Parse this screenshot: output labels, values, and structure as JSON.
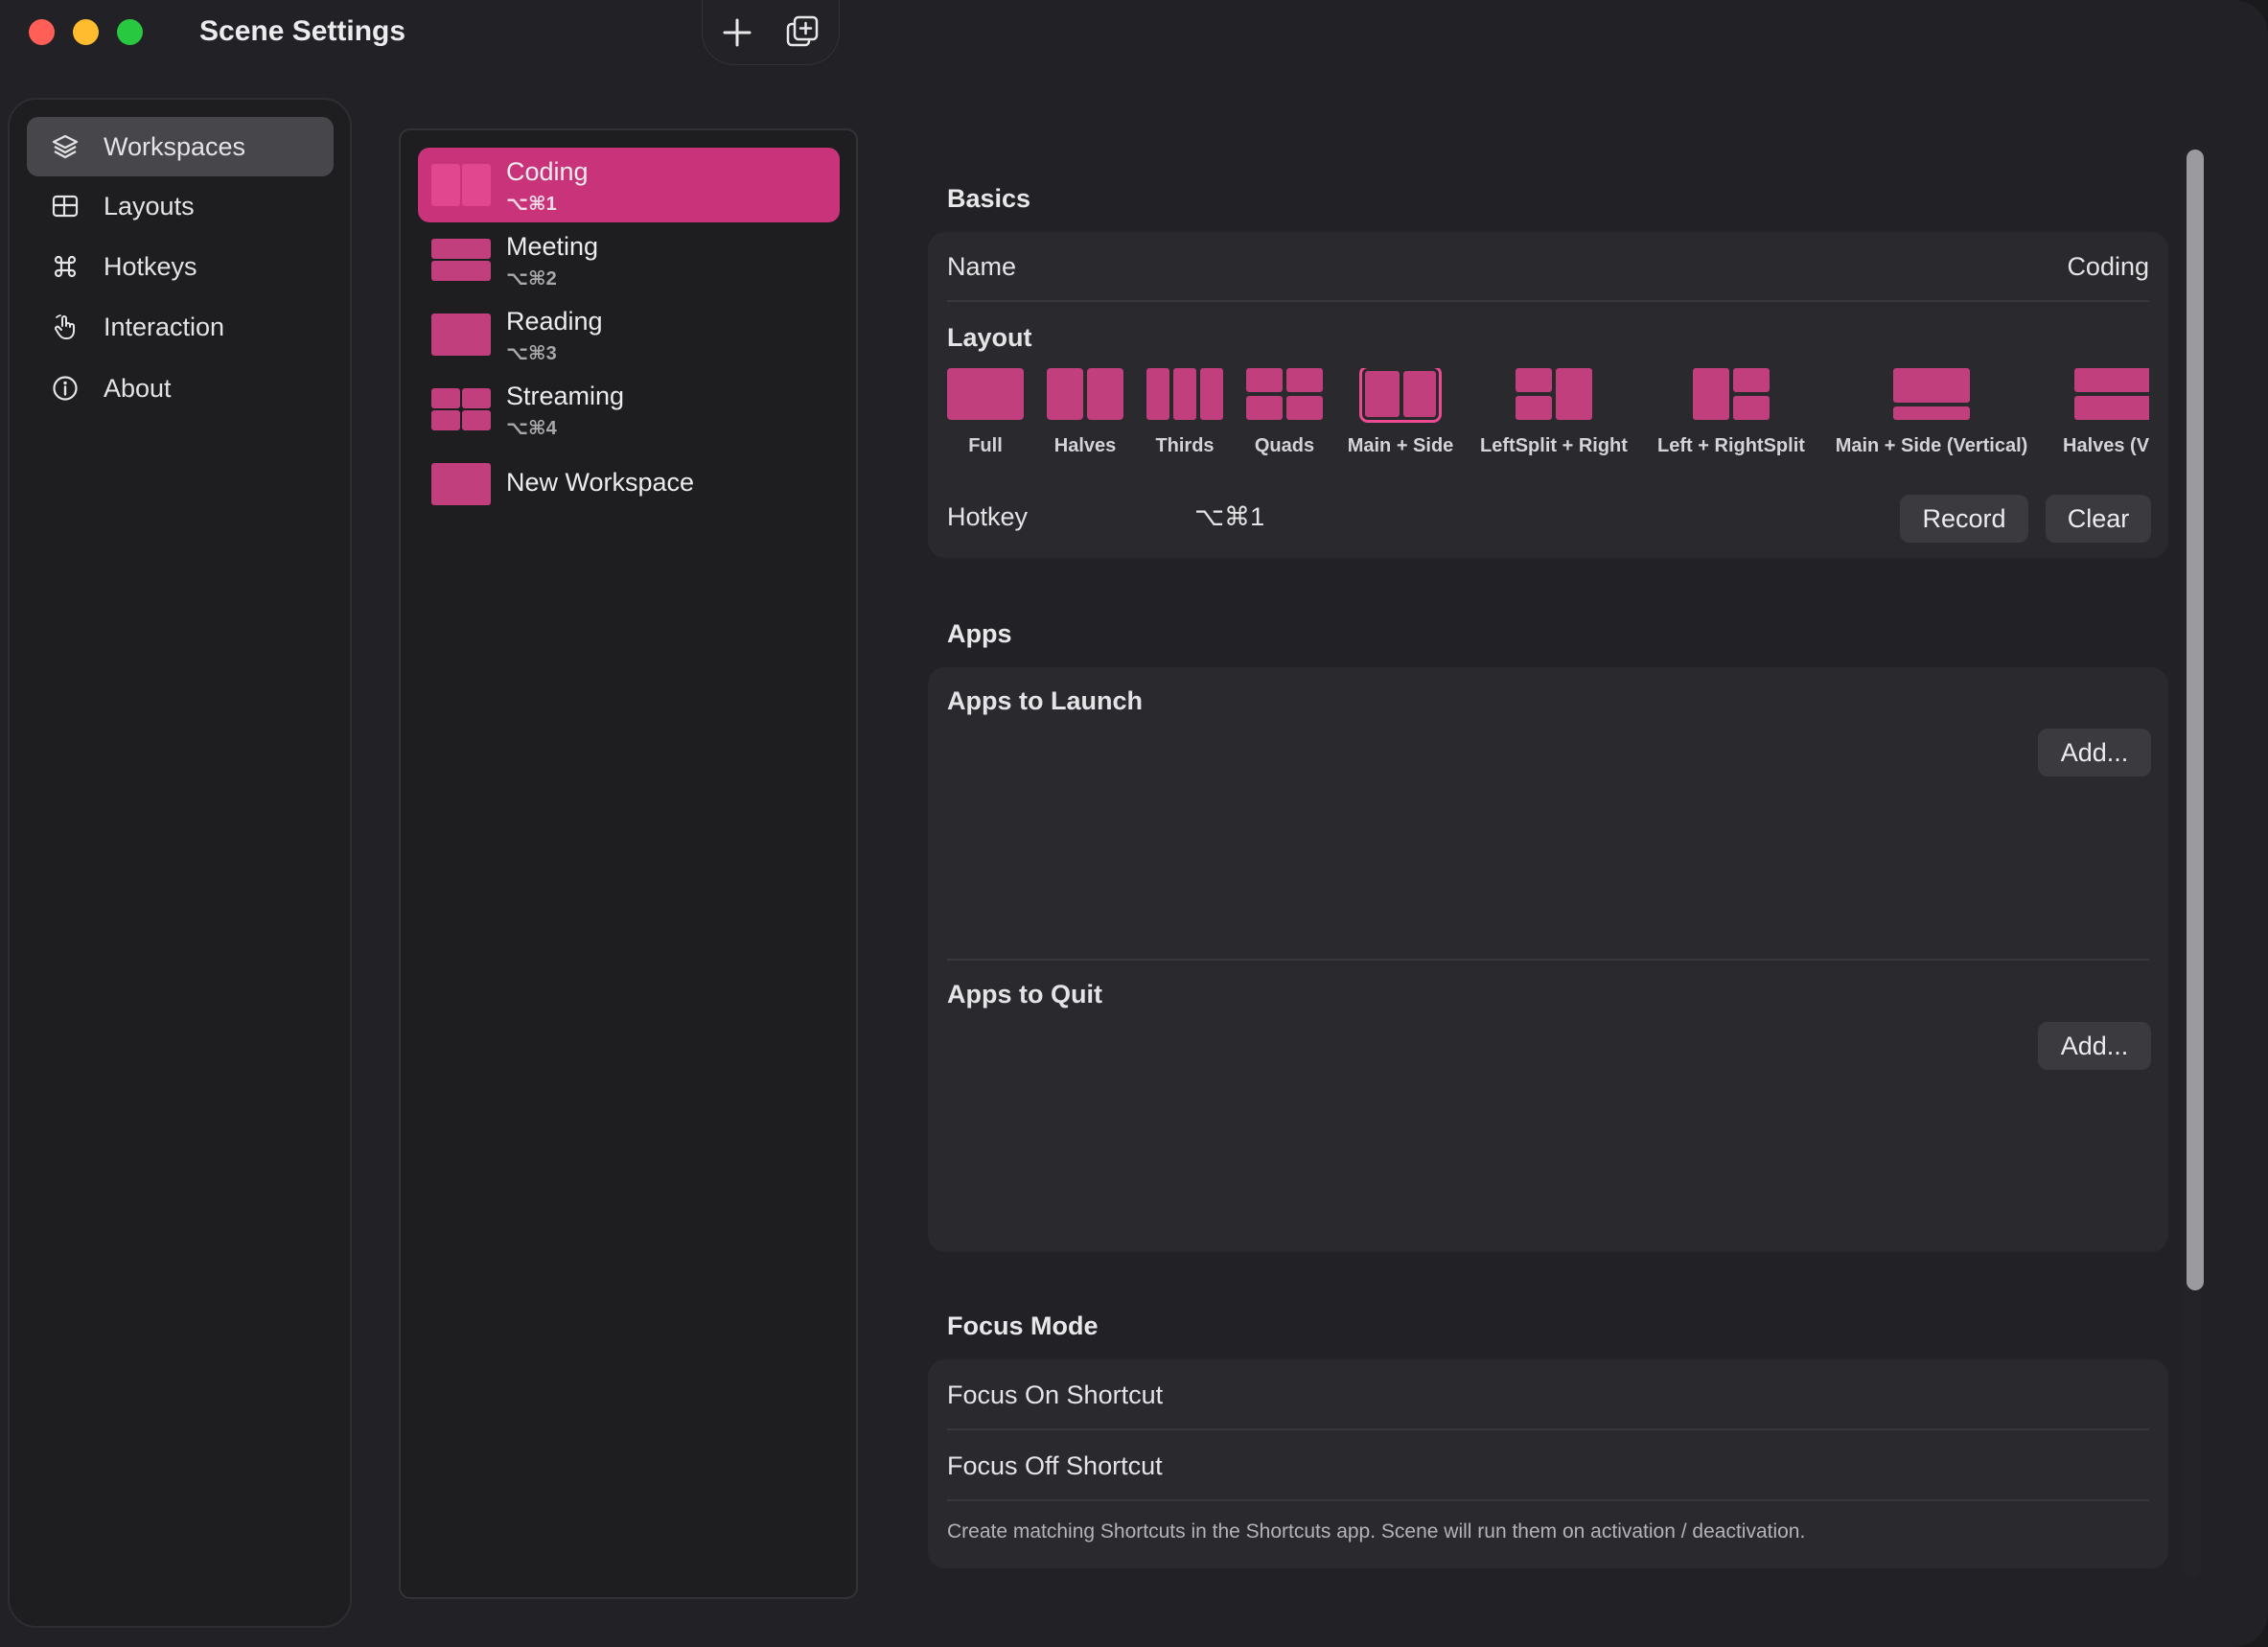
{
  "window": {
    "title": "Scene Settings"
  },
  "toolbar": {
    "add_icon": "plus-icon",
    "duplicate_icon": "duplicate-icon"
  },
  "sidebar": {
    "items": [
      {
        "label": "Workspaces",
        "icon": "layers-icon",
        "active": true
      },
      {
        "label": "Layouts",
        "icon": "grid-icon",
        "active": false
      },
      {
        "label": "Hotkeys",
        "icon": "command-icon",
        "active": false
      },
      {
        "label": "Interaction",
        "icon": "hand-pointer-icon",
        "active": false
      },
      {
        "label": "About",
        "icon": "info-icon",
        "active": false
      }
    ]
  },
  "workspaces": [
    {
      "name": "Coding",
      "hotkey": "⌥⌘1",
      "layout": "halves",
      "active": true
    },
    {
      "name": "Meeting",
      "hotkey": "⌥⌘2",
      "layout": "rows",
      "active": false
    },
    {
      "name": "Reading",
      "hotkey": "⌥⌘3",
      "layout": "full",
      "active": false
    },
    {
      "name": "Streaming",
      "hotkey": "⌥⌘4",
      "layout": "quads",
      "active": false
    },
    {
      "name": "New Workspace",
      "hotkey": "",
      "layout": "full",
      "active": false
    }
  ],
  "basics": {
    "section_title": "Basics",
    "name_label": "Name",
    "name_value": "Coding",
    "layout_label": "Layout",
    "layouts": [
      {
        "label": "Full",
        "kind": "full"
      },
      {
        "label": "Halves",
        "kind": "halves"
      },
      {
        "label": "Thirds",
        "kind": "thirds"
      },
      {
        "label": "Quads",
        "kind": "quads"
      },
      {
        "label": "Main + Side",
        "kind": "main-side",
        "selected": true
      },
      {
        "label": "LeftSplit + Right",
        "kind": "leftsplit-right"
      },
      {
        "label": "Left + RightSplit",
        "kind": "left-rightsplit"
      },
      {
        "label": "Main + Side (Vertical)",
        "kind": "main-side-vertical"
      },
      {
        "label": "Halves (V",
        "kind": "halves-vertical"
      }
    ],
    "hotkey_label": "Hotkey",
    "hotkey_value": "⌥⌘1",
    "record_label": "Record",
    "clear_label": "Clear"
  },
  "apps": {
    "section_title": "Apps",
    "launch_label": "Apps to Launch",
    "launch_add": "Add...",
    "quit_label": "Apps to Quit",
    "quit_add": "Add..."
  },
  "focus": {
    "section_title": "Focus Mode",
    "on_label": "Focus On Shortcut",
    "off_label": "Focus Off Shortcut",
    "helper": "Create matching Shortcuts in the Shortcuts app. Scene will run them on activation / deactivation."
  },
  "colors": {
    "accent": "#c8337a",
    "tile": "#c13f7c",
    "tile_light": "#e0478e"
  }
}
